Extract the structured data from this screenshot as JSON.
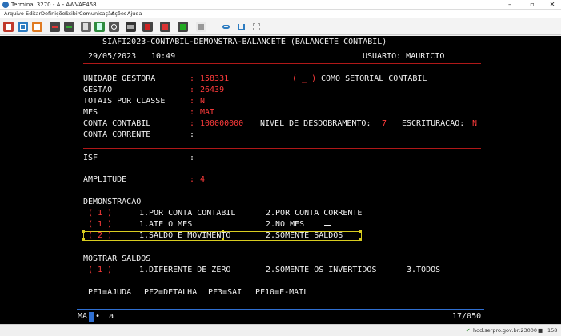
{
  "window": {
    "title": "Terminal 3270 - A - AWVAE458"
  },
  "menu": [
    "Arquivo",
    "Editar",
    "Definições",
    "Exibir",
    "Comunicação",
    "Ações",
    "Ajuda"
  ],
  "toolbar_icons": [
    "print-icon",
    "copy-screen-icon",
    "paste-icon",
    "send-file-icon",
    "receive-file-icon",
    "copy-icon",
    "paste-clipboard-icon",
    "reset-icon",
    "keyboard-icon",
    "macro-play-icon",
    "macro-stop-icon",
    "macro-record-icon",
    "link-icon",
    "upload-icon",
    "expand-icon"
  ],
  "terminal": {
    "header": "__ SIAFI2023-CONTABIL-DEMONSTRA-BALANCETE (BALANCETE CONTABIL)____________",
    "date": "29/05/2023",
    "time": "10:49",
    "user": "USUARIO: MAURICIO",
    "fields": {
      "unidade_gestora_label": "UNIDADE GESTORA",
      "unidade_gestora_value": "158331",
      "setorial_bracket": "( _ )",
      "setorial_label": "COMO SETORIAL CONTABIL",
      "gestao_label": "GESTAO",
      "gestao_value": "26439",
      "totais_label": "TOTAIS POR CLASSE",
      "totais_value": "N",
      "mes_label": "MES",
      "mes_value": "MAI",
      "conta_label": "CONTA CONTABIL",
      "conta_value": "100000000",
      "nivel_label": "NIVEL DE DESDOBRAMENTO:",
      "nivel_value": "7",
      "escrit_label": "ESCRITURACAO:",
      "escrit_value": "N",
      "conta_corrente_label": "CONTA CORRENTE",
      "isf_label": "ISF",
      "isf_value": "_",
      "amplitude_label": "AMPLITUDE",
      "amplitude_value": "4",
      "colon": ":"
    },
    "demonstracao": {
      "title": "DEMONSTRACAO",
      "rows": [
        {
          "sel": "( 1 )",
          "opt1": "1.POR CONTA CONTABIL",
          "opt2": "2.POR CONTA CORRENTE"
        },
        {
          "sel": "( 1 )",
          "opt1": "1.ATE O MES",
          "opt2": "2.NO MES"
        },
        {
          "sel": "( 2 )",
          "opt1": "1.SALDO E MOVIMENTO",
          "opt2": "2.SOMENTE SALDOS"
        }
      ]
    },
    "mostrar": {
      "title": "MOSTRAR SALDOS",
      "sel": "( 1 )",
      "opt1": "1.DIFERENTE DE ZERO",
      "opt2": "2.SOMENTE OS INVERTIDOS",
      "opt3": "3.TODOS"
    },
    "pfkeys": [
      "PF1=AJUDA",
      "PF2=DETALHA",
      "PF3=SAI",
      "PF10=E-MAIL"
    ],
    "oia_left": "MA",
    "oia_mark": "•",
    "oia_a": "a",
    "cursor_pos": "17/050"
  },
  "statusbar": {
    "host": "hod.serpro.gov.br:23000",
    "code": "158"
  },
  "colors": {
    "screen_bg": "#000000",
    "field_value": "#ff3b3b",
    "text": "#f2f2f2",
    "highlight": "#d8cc20",
    "cursor": "#2f6fd1"
  }
}
